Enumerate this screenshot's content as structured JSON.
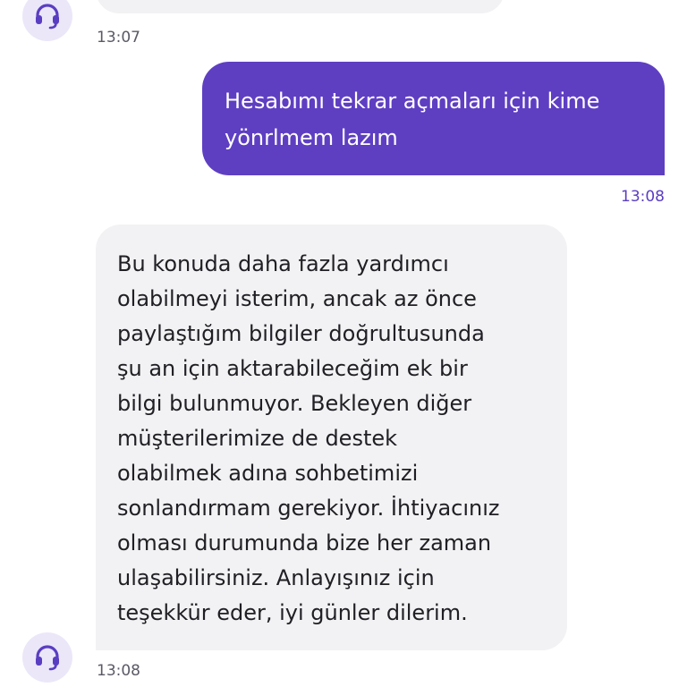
{
  "chat": {
    "previous": {
      "time": "13:07"
    },
    "user_message": {
      "lines": [
        "Hesabımı tekrar açmaları için kime",
        "yönrlmem lazım"
      ],
      "time": "13:08"
    },
    "agent_message": {
      "lines": [
        "Bu konuda daha fazla yardımcı",
        "olabilmeyi isterim, ancak az önce",
        "paylaştığım bilgiler doğrultusunda",
        "şu an için aktarabileceğim ek bir",
        "bilgi bulunmuyor. Bekleyen diğer",
        "müşterilerimize de destek",
        "olabilmek adına sohbetimizi",
        "sonlandırmam gerekiyor. İhtiyacınız",
        "olması durumunda bize her zaman",
        "ulaşabilirsiniz. Anlayışınız için",
        "teşekkür eder, iyi günler dilerim."
      ],
      "time": "13:08"
    }
  },
  "icons": {
    "agent_avatar": "headset-icon"
  },
  "colors": {
    "user_bubble": "#5e3fc2",
    "agent_bubble": "#f2f2f4",
    "avatar_bg": "#ebe7f9",
    "avatar_icon": "#5a3ec2",
    "user_time": "#5a3ec2",
    "agent_time": "#5a5a66"
  }
}
